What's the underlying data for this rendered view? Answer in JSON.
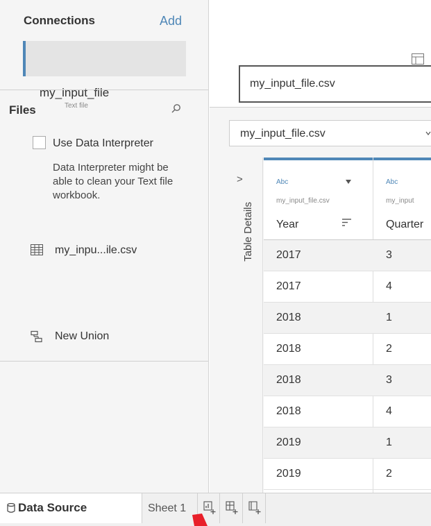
{
  "connections": {
    "header": "Connections",
    "add_label": "Add",
    "item": {
      "name": "my_input_file",
      "type": "Text file"
    }
  },
  "files": {
    "header": "Files",
    "use_data_interpreter": "Use Data Interpreter",
    "interpreter_description": "Data Interpreter might be able to clean your Text file workbook.",
    "file_name": "my_inpu...ile.csv",
    "new_union": "New Union"
  },
  "canvas": {
    "table_label": "my_input_file.csv"
  },
  "grid": {
    "table_select": "my_input_file.csv",
    "details_toggle": ">",
    "details_label": "Table Details",
    "columns": [
      {
        "type": "Abc",
        "source": "my_input_file.csv",
        "name": "Year"
      },
      {
        "type": "Abc",
        "source": "my_input",
        "name": "Quarter"
      }
    ],
    "rows": [
      [
        "2017",
        "3"
      ],
      [
        "2017",
        "4"
      ],
      [
        "2018",
        "1"
      ],
      [
        "2018",
        "2"
      ],
      [
        "2018",
        "3"
      ],
      [
        "2018",
        "4"
      ],
      [
        "2019",
        "1"
      ],
      [
        "2019",
        "2"
      ]
    ]
  },
  "tabs": {
    "data_source": "Data Source",
    "sheet1": "Sheet 1"
  },
  "colors": {
    "accent": "#4f87b7",
    "panel_bg": "#f5f5f5",
    "flag": "#e8202a"
  }
}
